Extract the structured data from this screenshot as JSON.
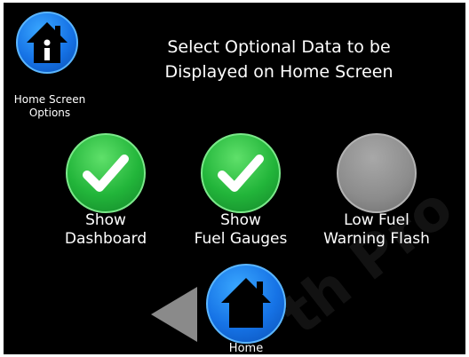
{
  "header": {
    "icon": "home-info-icon",
    "label_line1": "Home Screen",
    "label_line2": "Options"
  },
  "title": {
    "line1": "Select Optional Data to be",
    "line2": "Displayed on Home Screen"
  },
  "options": [
    {
      "line1": "Show",
      "line2": "Dashboard",
      "state": "on",
      "icon": "checkmark-icon"
    },
    {
      "line1": "Show",
      "line2": "Fuel Gauges",
      "state": "on",
      "icon": "checkmark-icon"
    },
    {
      "line1": "Low Fuel",
      "line2": "Warning Flash",
      "state": "off",
      "icon": "none"
    }
  ],
  "nav": {
    "back_icon": "back-arrow-icon",
    "home_icon": "home-icon",
    "home_label": "Home"
  },
  "watermark": "th Pro",
  "colors": {
    "background": "#000000",
    "accent_blue": "#1673e6",
    "on_green": "#22b53a",
    "off_gray": "#8c8c8c",
    "text": "#ffffff"
  }
}
